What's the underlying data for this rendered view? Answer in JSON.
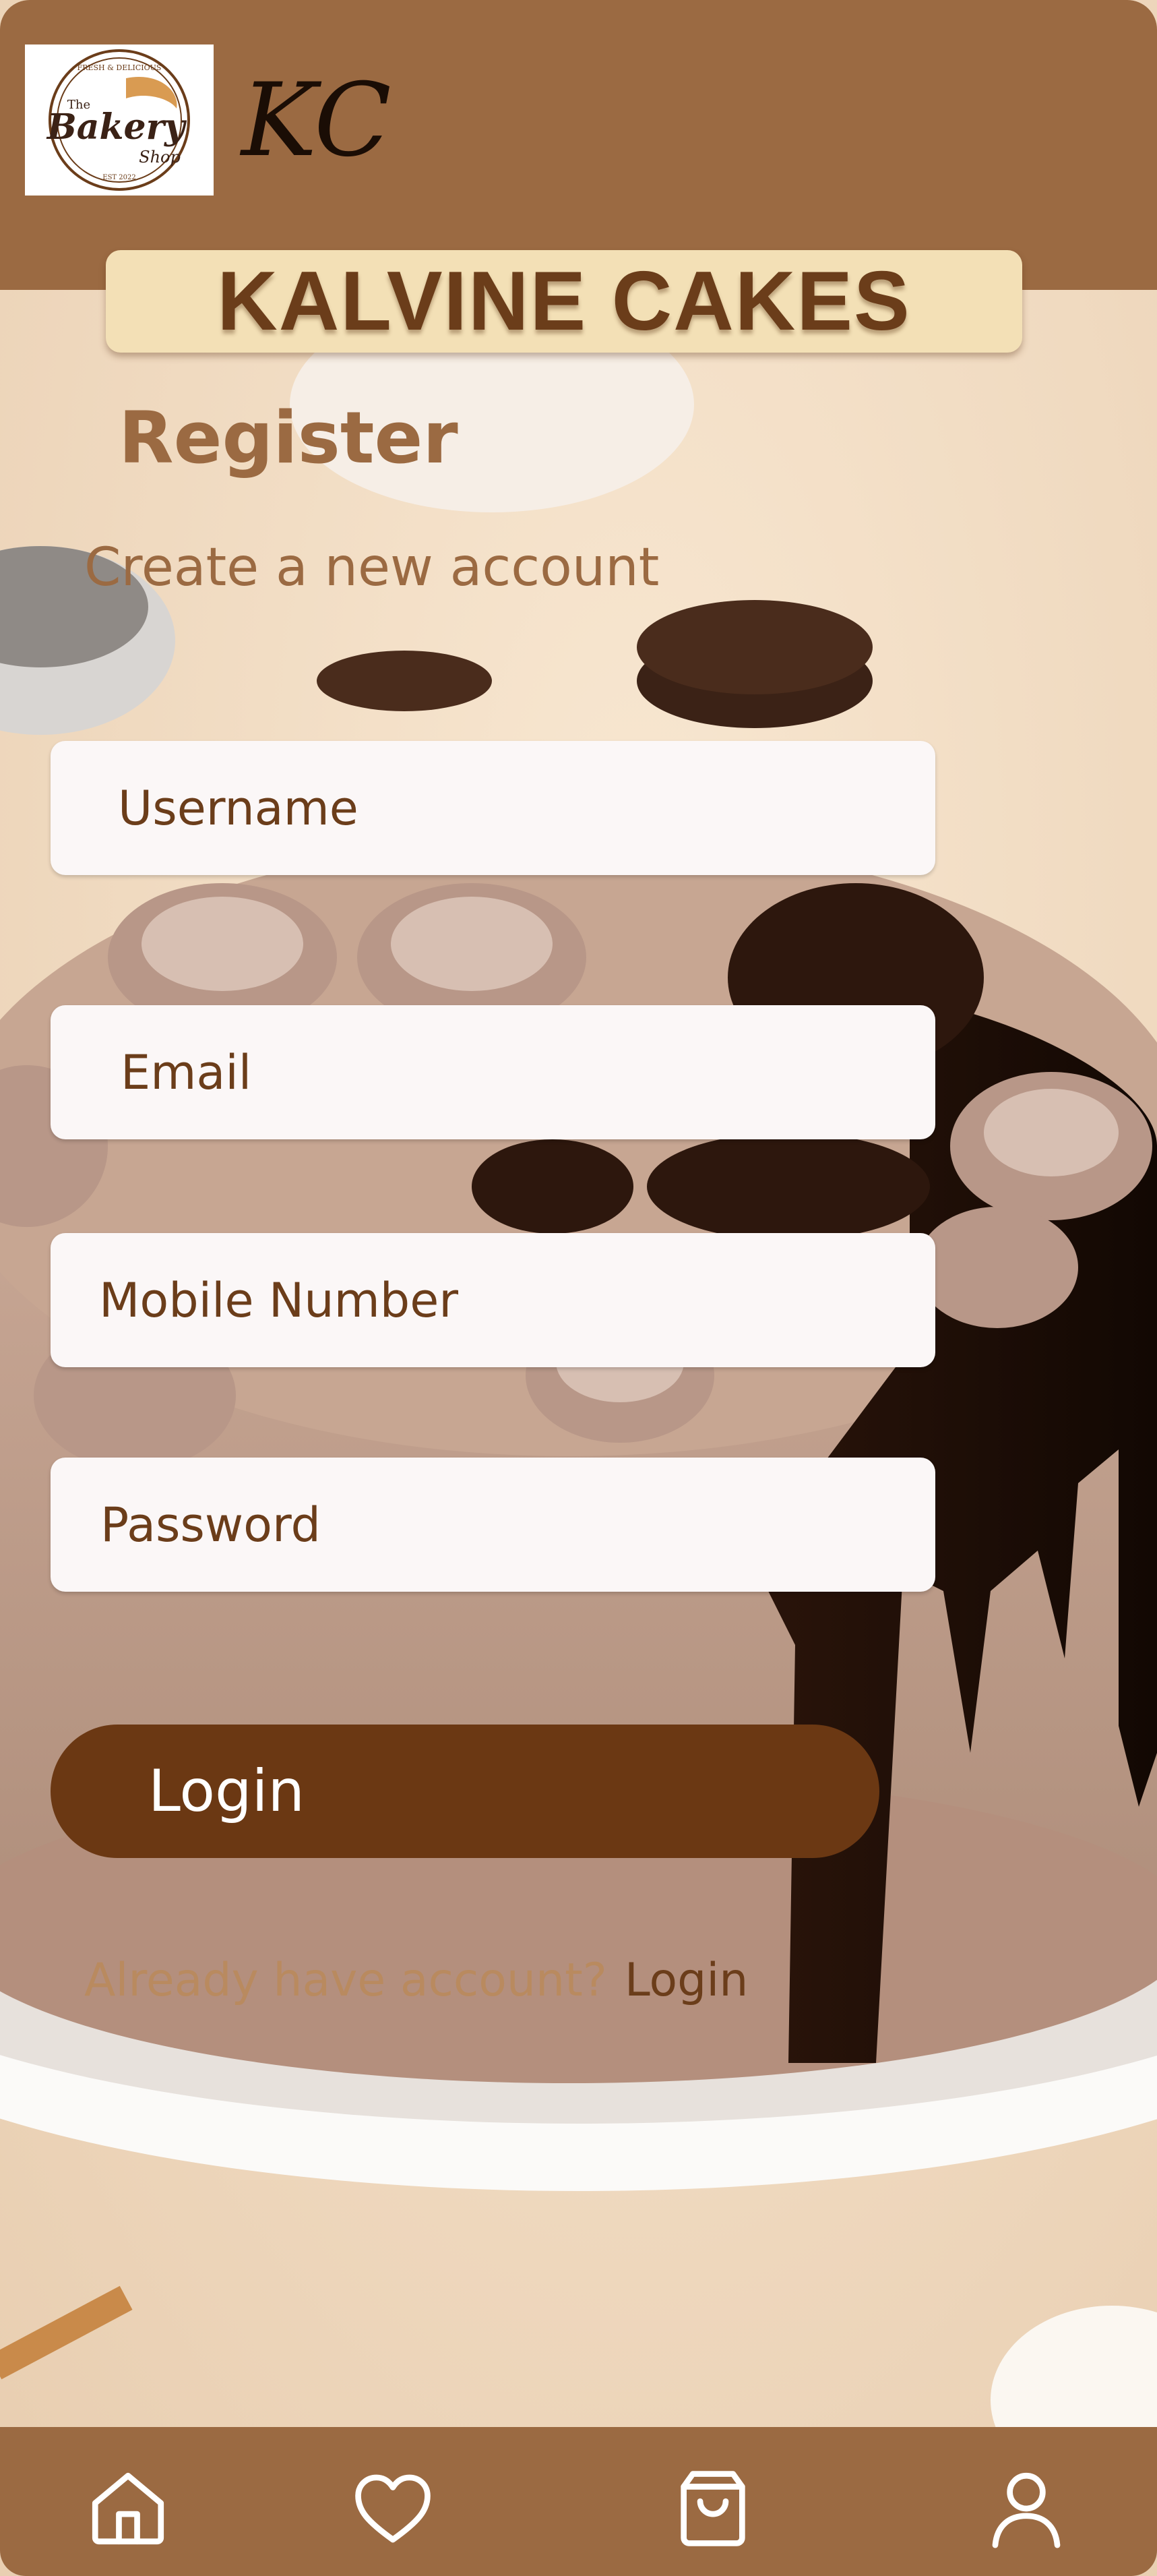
{
  "header": {
    "logo": {
      "icon": "bakery-shop-logo",
      "lines": [
        "FRESH & DELICIOUS",
        "The",
        "Bakery",
        "Shop",
        "EST 2022"
      ]
    },
    "monogram": "KC"
  },
  "brand": {
    "title": "KALVINE CAKES"
  },
  "form": {
    "title": "Register",
    "subtitle": "Create a new account",
    "username_placeholder": "Username",
    "email_placeholder": "Email",
    "mobile_placeholder": "Mobile Number",
    "password_placeholder": "Password",
    "submit_label": "Login"
  },
  "footer_link": {
    "question": "Already have account?",
    "link_label": "Login"
  },
  "bottom_nav": {
    "items": [
      {
        "icon": "home-icon"
      },
      {
        "icon": "heart-icon"
      },
      {
        "icon": "shopping-bag-icon"
      },
      {
        "icon": "user-icon"
      }
    ]
  },
  "colors": {
    "header_brown": "#9b6a42",
    "banner_cream": "#f3e0b6",
    "title_brown": "#6b3d1a",
    "button_brown": "#6b3813",
    "field_bg": "#fbf7f7",
    "muted_text": "#b98a5f"
  }
}
